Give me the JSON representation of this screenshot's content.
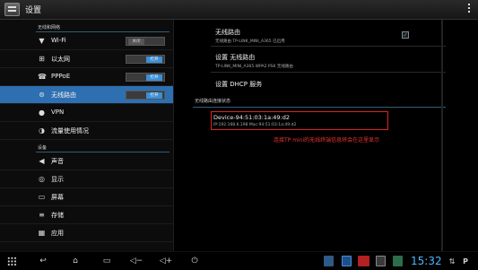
{
  "app": {
    "title": "设置"
  },
  "sidebar": {
    "sections": [
      {
        "label": "无线和网络"
      },
      {
        "label": "设备"
      }
    ],
    "items": [
      {
        "label": "Wi-Fi",
        "icon": "wifi-icon",
        "toggle": "关闭"
      },
      {
        "label": "以太网",
        "icon": "ethernet-icon",
        "toggle": "打开"
      },
      {
        "label": "PPPoE",
        "icon": "phone-icon",
        "toggle": "打开"
      },
      {
        "label": "无线路由",
        "icon": "hotspot-icon",
        "toggle": "打开",
        "selected": true
      },
      {
        "label": "VPN",
        "icon": "vpn-icon"
      },
      {
        "label": "流量使用情况",
        "icon": "data-usage-icon"
      },
      {
        "label": "声音",
        "icon": "sound-icon"
      },
      {
        "label": "显示",
        "icon": "display-icon"
      },
      {
        "label": "屏幕",
        "icon": "screen-icon"
      },
      {
        "label": "存储",
        "icon": "storage-icon"
      },
      {
        "label": "应用",
        "icon": "apps-icon"
      }
    ]
  },
  "main": {
    "prefs": [
      {
        "title": "无线路由",
        "summary": "无线路由 TP-LINK_MINI_A365 已启用",
        "checked": true
      },
      {
        "title": "设置 无线路由",
        "summary": "TP-LINK_MINI_A365 WPA2 PSK 无线路由"
      },
      {
        "title": "设置 DHCP 服务"
      }
    ],
    "status_category": "无线路由连接状态",
    "device": {
      "name": "Device-94:51:03:1a:49:d2",
      "info": "IP:192.168.6.198  Mac:94:51:03:1a:49:d2"
    },
    "annotation": "连接TP mini的无线终端信息将会在这里显示"
  },
  "navbar": {
    "time": "15:32",
    "accent": "#4fb6ff"
  }
}
